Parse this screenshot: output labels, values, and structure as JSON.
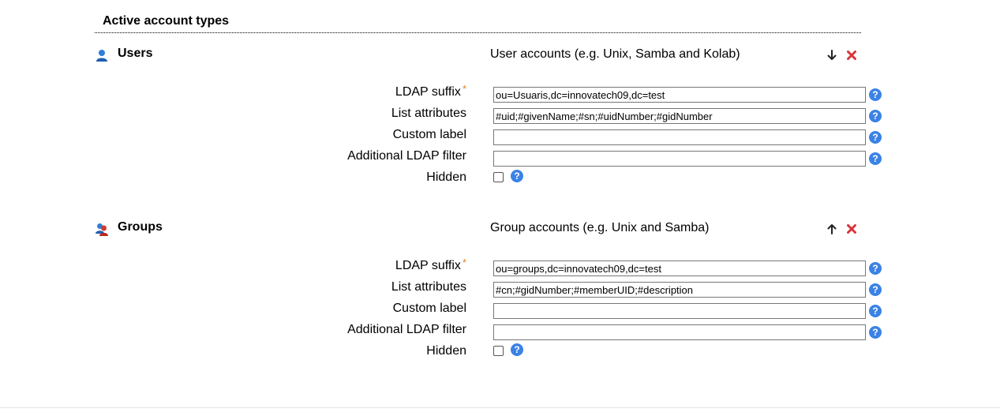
{
  "section": {
    "title": "Active account types"
  },
  "account_types": [
    {
      "name": "Users",
      "description": "User accounts (e.g. Unix, Samba and Kolab)",
      "icon": "user-icon",
      "move_icon": "arrow-down-icon",
      "fields": {
        "ldap_suffix": {
          "label": "LDAP suffix",
          "required_mark": "*",
          "value": "ou=Usuaris,dc=innovatech09,dc=test"
        },
        "list_attributes": {
          "label": "List attributes",
          "value": "#uid;#givenName;#sn;#uidNumber;#gidNumber"
        },
        "custom_label": {
          "label": "Custom label",
          "value": ""
        },
        "additional_filter": {
          "label": "Additional LDAP filter",
          "value": ""
        },
        "hidden": {
          "label": "Hidden",
          "checked": false
        }
      }
    },
    {
      "name": "Groups",
      "description": "Group accounts (e.g. Unix and Samba)",
      "icon": "group-icon",
      "move_icon": "arrow-up-icon",
      "fields": {
        "ldap_suffix": {
          "label": "LDAP suffix",
          "required_mark": "*",
          "value": "ou=groups,dc=innovatech09,dc=test"
        },
        "list_attributes": {
          "label": "List attributes",
          "value": "#cn;#gidNumber;#memberUID;#description"
        },
        "custom_label": {
          "label": "Custom label",
          "value": ""
        },
        "additional_filter": {
          "label": "Additional LDAP filter",
          "value": ""
        },
        "hidden": {
          "label": "Hidden",
          "checked": false
        }
      }
    }
  ],
  "help_glyph": "?",
  "colors": {
    "help": "#3b82e6",
    "delete": "#d9343a",
    "required": "#e08020"
  }
}
